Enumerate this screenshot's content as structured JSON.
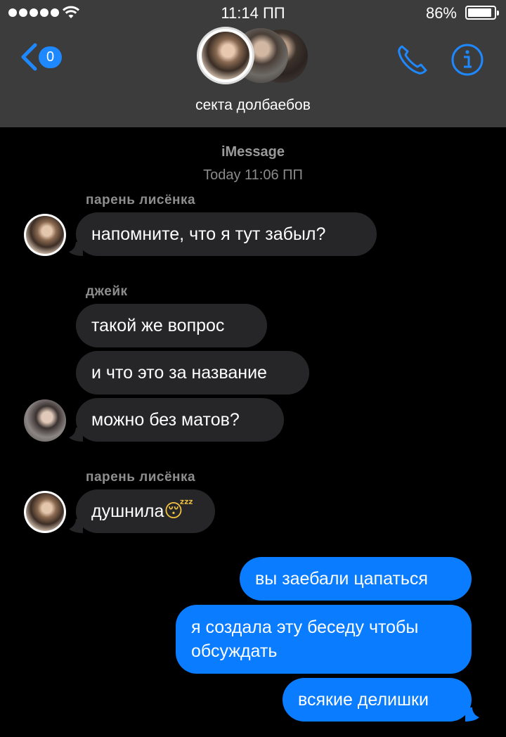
{
  "status_bar": {
    "time": "11:14 ПП",
    "battery_percent": "86%",
    "battery_level": 0.86,
    "signal_dots": 5
  },
  "header": {
    "unread_count": "0",
    "group_name": "секта долбаебов",
    "icons": [
      "chevron-left-icon",
      "phone-icon",
      "info-icon"
    ]
  },
  "thread": {
    "service": "iMessage",
    "timestamp_day": "Today",
    "timestamp_time": "11:06 ПП",
    "messages": [
      {
        "sender": "парень лисёнка",
        "text": "напомните, что я тут забыл?",
        "direction": "in"
      },
      {
        "sender": "джейк",
        "text": "такой же вопрос",
        "direction": "in"
      },
      {
        "sender": "",
        "text": "и что это за название",
        "direction": "in"
      },
      {
        "sender": "",
        "text": "можно без матов?",
        "direction": "in"
      },
      {
        "sender": "парень лисёнка",
        "text": "душнила",
        "emoji": "😴",
        "direction": "in"
      },
      {
        "sender": "",
        "text": "вы заебали цапаться",
        "direction": "out"
      },
      {
        "sender": "",
        "text": "я создала эту беседу чтобы обсуждать",
        "direction": "out"
      },
      {
        "sender": "",
        "text": "всякие делишки",
        "direction": "out"
      }
    ]
  },
  "colors": {
    "header_bg": "#3c3c3c",
    "incoming_bubble": "#262628",
    "outgoing_bubble": "#0a7cff",
    "accent": "#1e88ff"
  }
}
